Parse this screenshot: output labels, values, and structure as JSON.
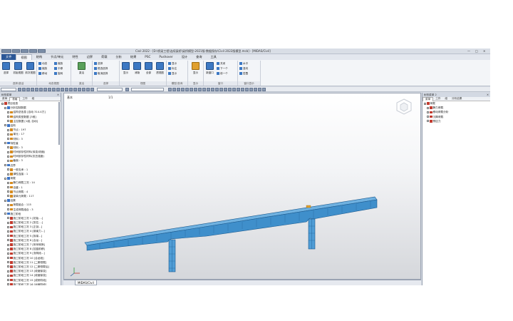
{
  "window": {
    "title": "Civil 2022 - [D:\\桥梁工程\\连续梁桥\\梁桥模型-2021版-数据保存\\Civil 2022版模型.mcb] - [MIDAS/Civil]",
    "minimize": "—",
    "restore": "□",
    "close": "✕"
  },
  "ribbon_tabs": [
    "文件",
    "视图",
    "结构",
    "节点/单元",
    "特性",
    "边界",
    "荷载",
    "分析",
    "结果",
    "PSC",
    "Pushover",
    "设计",
    "查询",
    "工具"
  ],
  "ribbon": {
    "groups": [
      {
        "label": "选择/激活",
        "big": [
          "选择",
          "初始视图",
          "前次视图"
        ]
      },
      {
        "label": "动态视图",
        "small": [
          "动态",
          "缩放",
          "移动"
        ],
        "small2": [
          "缩放",
          "平移",
          "旋转"
        ]
      },
      {
        "label": "激活",
        "big": [
          "激活"
        ]
      },
      {
        "label": "选择",
        "small": [
          "选择",
          "框选选择",
          "取消选择"
        ]
      },
      {
        "label": "视图",
        "big": [
          "显示",
          "消隐",
          "全部",
          "透视图"
        ]
      },
      {
        "label": "模型/查询",
        "small": [
          "显示",
          "标注",
          "显示"
        ]
      },
      {
        "label": "显示",
        "big": [
          "显示"
        ]
      },
      {
        "label": "窗口",
        "big": [
          "新窗口"
        ],
        "small": [
          "关闭",
          "下一个",
          "前一个"
        ]
      },
      {
        "label": "窗口显示",
        "small": [
          "水平",
          "竖向",
          "层叠"
        ]
      }
    ]
  },
  "toolbar": {
    "field1": "",
    "field2": ""
  },
  "tree_panel": {
    "header": "树形菜单",
    "close": "✕",
    "tabs": [
      "菜单",
      "表格",
      "工作",
      "组"
    ],
    "items": [
      {
        "indent": 0,
        "icon": "r",
        "text": "项目信息"
      },
      {
        "indent": 1,
        "icon": "b",
        "text": "分析控制数据"
      },
      {
        "indent": 2,
        "icon": "o",
        "text": "结构总信息 [自动 314.4方]"
      },
      {
        "indent": 2,
        "icon": "o",
        "text": "结构类型数据 [3维]"
      },
      {
        "indent": 2,
        "icon": "o",
        "text": "主控数据 [1组, 自动]"
      },
      {
        "indent": 1,
        "icon": "b",
        "text": "结构"
      },
      {
        "indent": 2,
        "icon": "o",
        "text": "节点 : 197"
      },
      {
        "indent": 2,
        "icon": "o",
        "text": "单元 : 17"
      },
      {
        "indent": 2,
        "icon": "o",
        "text": "材料 : 3"
      },
      {
        "indent": 1,
        "icon": "b",
        "text": "特性值"
      },
      {
        "indent": 2,
        "icon": "o",
        "text": "材料 : 3"
      },
      {
        "indent": 2,
        "icon": "o",
        "text": "时间依存性材料(徐变/收缩)"
      },
      {
        "indent": 2,
        "icon": "o",
        "text": "时间依存性材料(抗压强度)"
      },
      {
        "indent": 2,
        "icon": "o",
        "text": "截面 : 3"
      },
      {
        "indent": 1,
        "icon": "b",
        "text": "边界"
      },
      {
        "indent": 2,
        "icon": "o",
        "text": "一般支承 : 1"
      },
      {
        "indent": 2,
        "icon": "o",
        "text": "弹性连接 : 1"
      },
      {
        "indent": 1,
        "icon": "b",
        "text": "荷载"
      },
      {
        "indent": 2,
        "icon": "o",
        "text": "静力荷载工况 : 14"
      },
      {
        "indent": 2,
        "icon": "o",
        "text": "自重 : 1"
      },
      {
        "indent": 2,
        "icon": "o",
        "text": "节点荷载 : 4"
      },
      {
        "indent": 2,
        "icon": "o",
        "text": "梁单元荷载 : 117"
      },
      {
        "indent": 1,
        "icon": "b",
        "text": "结果"
      },
      {
        "indent": 2,
        "icon": "o",
        "text": "荷载组合 : 115"
      },
      {
        "indent": 2,
        "icon": "o",
        "text": "生成荷载组合 : 3"
      },
      {
        "indent": 1,
        "icon": "b",
        "text": "施工阶段"
      },
      {
        "indent": 2,
        "icon": "r",
        "text": "施工阶段工况 1 [初始 ...]"
      },
      {
        "indent": 2,
        "icon": "r",
        "text": "施工阶段工况 2 [张拉 ...]"
      },
      {
        "indent": 2,
        "icon": "r",
        "text": "施工阶段工况 3 [正剖...]"
      },
      {
        "indent": 2,
        "icon": "r",
        "text": "施工阶段工况 4 [钢束力...]"
      },
      {
        "indent": 2,
        "icon": "r",
        "text": "施工阶段工况 5 [拆架...]"
      },
      {
        "indent": 2,
        "icon": "r",
        "text": "施工阶段工况 6 [合龙...]"
      },
      {
        "indent": 2,
        "icon": "r",
        "text": "施工阶段工况 7 [体系转换]"
      },
      {
        "indent": 2,
        "icon": "r",
        "text": "施工阶段工况 8 [挂篮前移]"
      },
      {
        "indent": 2,
        "icon": "r",
        "text": "施工阶段工况 9 [浇筑段...]"
      },
      {
        "indent": 2,
        "icon": "r",
        "text": "施工阶段工况 10 [合龙段]"
      },
      {
        "indent": 2,
        "icon": "r",
        "text": "施工阶段工况 11 [二期恒载]"
      },
      {
        "indent": 2,
        "icon": "r",
        "text": "施工阶段工况 12 [二期恒载后]"
      },
      {
        "indent": 2,
        "icon": "r",
        "text": "施工阶段工况 13 [收缩徐变]"
      },
      {
        "indent": 2,
        "icon": "r",
        "text": "施工阶段工况 14 [收缩徐变]"
      },
      {
        "indent": 2,
        "icon": "r",
        "text": "施工阶段工况 15 [成桥阶段]"
      },
      {
        "indent": 2,
        "icon": "r",
        "text": "施工阶段工况 16 [运营阶段]"
      },
      {
        "indent": 2,
        "icon": "r",
        "text": "施工阶段工况 17 [运营阶段]"
      }
    ]
  },
  "viewport": {
    "label_left": "基本",
    "label_mid": "1/1"
  },
  "view_tabs": [
    "MIDAS/Civil"
  ],
  "right_panel": {
    "header": "树形菜单 2",
    "close": "✕",
    "tabs": [
      "菜单",
      "工作",
      "组",
      "分析结果"
    ],
    "items": [
      {
        "indent": 0,
        "icon": "r",
        "text": "荷载"
      },
      {
        "indent": 1,
        "icon": "r",
        "text": "静力荷载"
      },
      {
        "indent": 1,
        "icon": "r",
        "text": "移动荷载分析"
      },
      {
        "indent": 1,
        "icon": "r",
        "text": "沉降荷载"
      },
      {
        "indent": 1,
        "icon": "r",
        "text": "预应力"
      }
    ]
  },
  "colors": {
    "bridge_fill": "#4f9dd6",
    "bridge_edge": "#1d5b8f",
    "accent_blue": "#2b5797"
  }
}
